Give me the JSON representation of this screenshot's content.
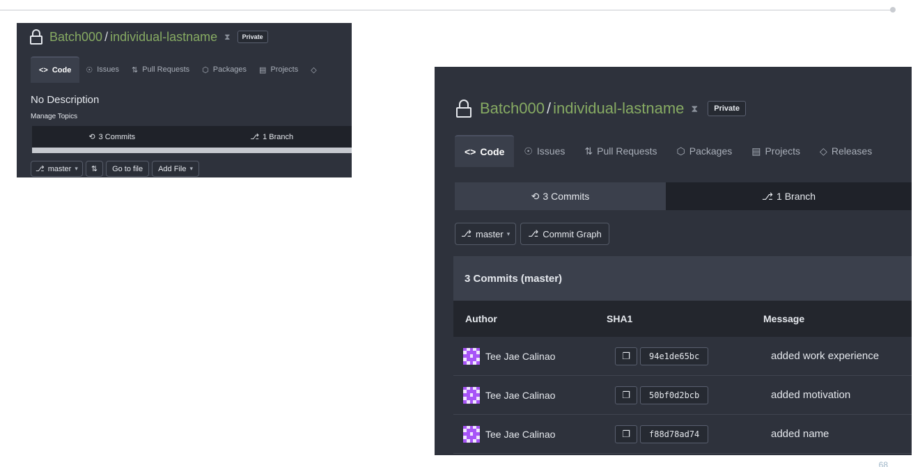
{
  "repo": {
    "owner": "Batch000",
    "separator": "/",
    "name": "individual-lastname",
    "visibility": "Private"
  },
  "tabs": [
    {
      "label": "Code",
      "icon": "code-icon",
      "active": true
    },
    {
      "label": "Issues",
      "icon": "issue-icon",
      "active": false
    },
    {
      "label": "Pull Requests",
      "icon": "pull-request-icon",
      "active": false
    },
    {
      "label": "Packages",
      "icon": "package-icon",
      "active": false
    },
    {
      "label": "Projects",
      "icon": "project-icon",
      "active": false
    },
    {
      "label": "Releases",
      "icon": "tag-icon",
      "active": false
    }
  ],
  "small": {
    "description": "No Description",
    "manage_topics": "Manage Topics",
    "commits": "3 Commits",
    "branches": "1 Branch",
    "branch": "master",
    "go_to_file": "Go to file",
    "add_file": "Add File"
  },
  "large": {
    "commits": "3 Commits",
    "branches": "1 Branch",
    "branch": "master",
    "commit_graph": "Commit Graph",
    "table_title": "3 Commits (master)",
    "headers": {
      "author": "Author",
      "sha": "SHA1",
      "message": "Message"
    },
    "rows": [
      {
        "author": "Tee Jae Calinao",
        "sha": "94e1de65bc",
        "message": "added work experience"
      },
      {
        "author": "Tee Jae Calinao",
        "sha": "50bf0d2bcb",
        "message": "added motivation"
      },
      {
        "author": "Tee Jae Calinao",
        "sha": "f88d78ad74",
        "message": "added name"
      }
    ]
  },
  "page_number": "68",
  "colors": {
    "background": "#2e323c",
    "repo_link": "#87ab63",
    "avatar": "#a855f7"
  }
}
